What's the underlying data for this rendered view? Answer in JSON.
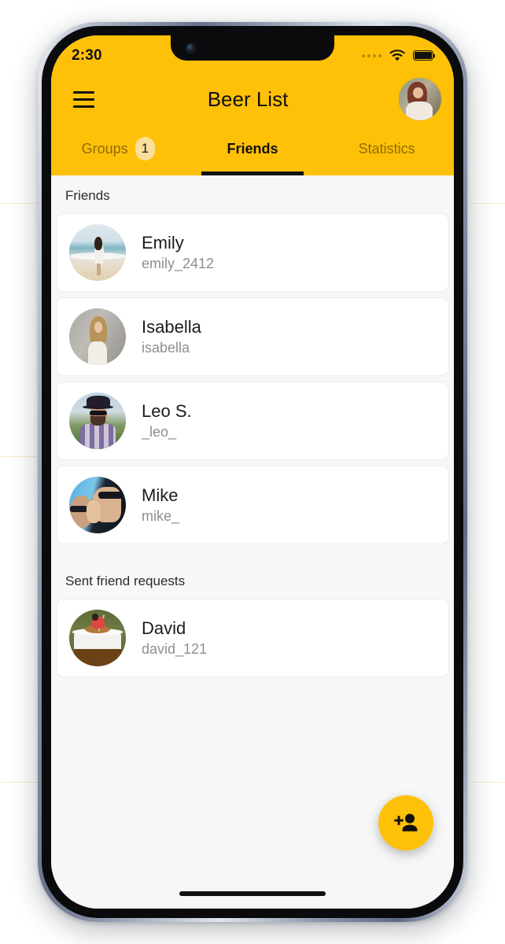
{
  "theme": {
    "brand_color": "#ffc107",
    "badge_color": "#fae09a",
    "screen_bg": "#f7f7f7",
    "card_bg": "#ffffff",
    "text_primary": "#1b1b1b",
    "text_secondary": "#8e8e8e"
  },
  "status_bar": {
    "time": "2:30",
    "signal_icon": "signal-dots-icon",
    "wifi_icon": "wifi-icon",
    "battery_icon": "battery-full-icon"
  },
  "header": {
    "menu_icon": "hamburger-menu-icon",
    "title": "Beer List",
    "avatar_icon": "user-avatar-image"
  },
  "tabs": [
    {
      "label": "Groups",
      "badge": "1",
      "active": false
    },
    {
      "label": "Friends",
      "badge": null,
      "active": true
    },
    {
      "label": "Statistics",
      "badge": null,
      "active": false
    }
  ],
  "sections": [
    {
      "title": "Friends",
      "items": [
        {
          "name": "Emily",
          "handle": "emily_2412",
          "avatar": "avatar-emily"
        },
        {
          "name": "Isabella",
          "handle": "isabella",
          "avatar": "avatar-isabella"
        },
        {
          "name": "Leo S.",
          "handle": "_leo_",
          "avatar": "avatar-leo"
        },
        {
          "name": "Mike",
          "handle": "mike_",
          "avatar": "avatar-mike"
        }
      ]
    },
    {
      "title": "Sent friend requests",
      "items": [
        {
          "name": "David",
          "handle": "david_121",
          "avatar": "avatar-david"
        }
      ]
    }
  ],
  "fab": {
    "icon": "person-add-icon",
    "label": "Add friend"
  },
  "system": {
    "home_indicator": "home-indicator"
  }
}
